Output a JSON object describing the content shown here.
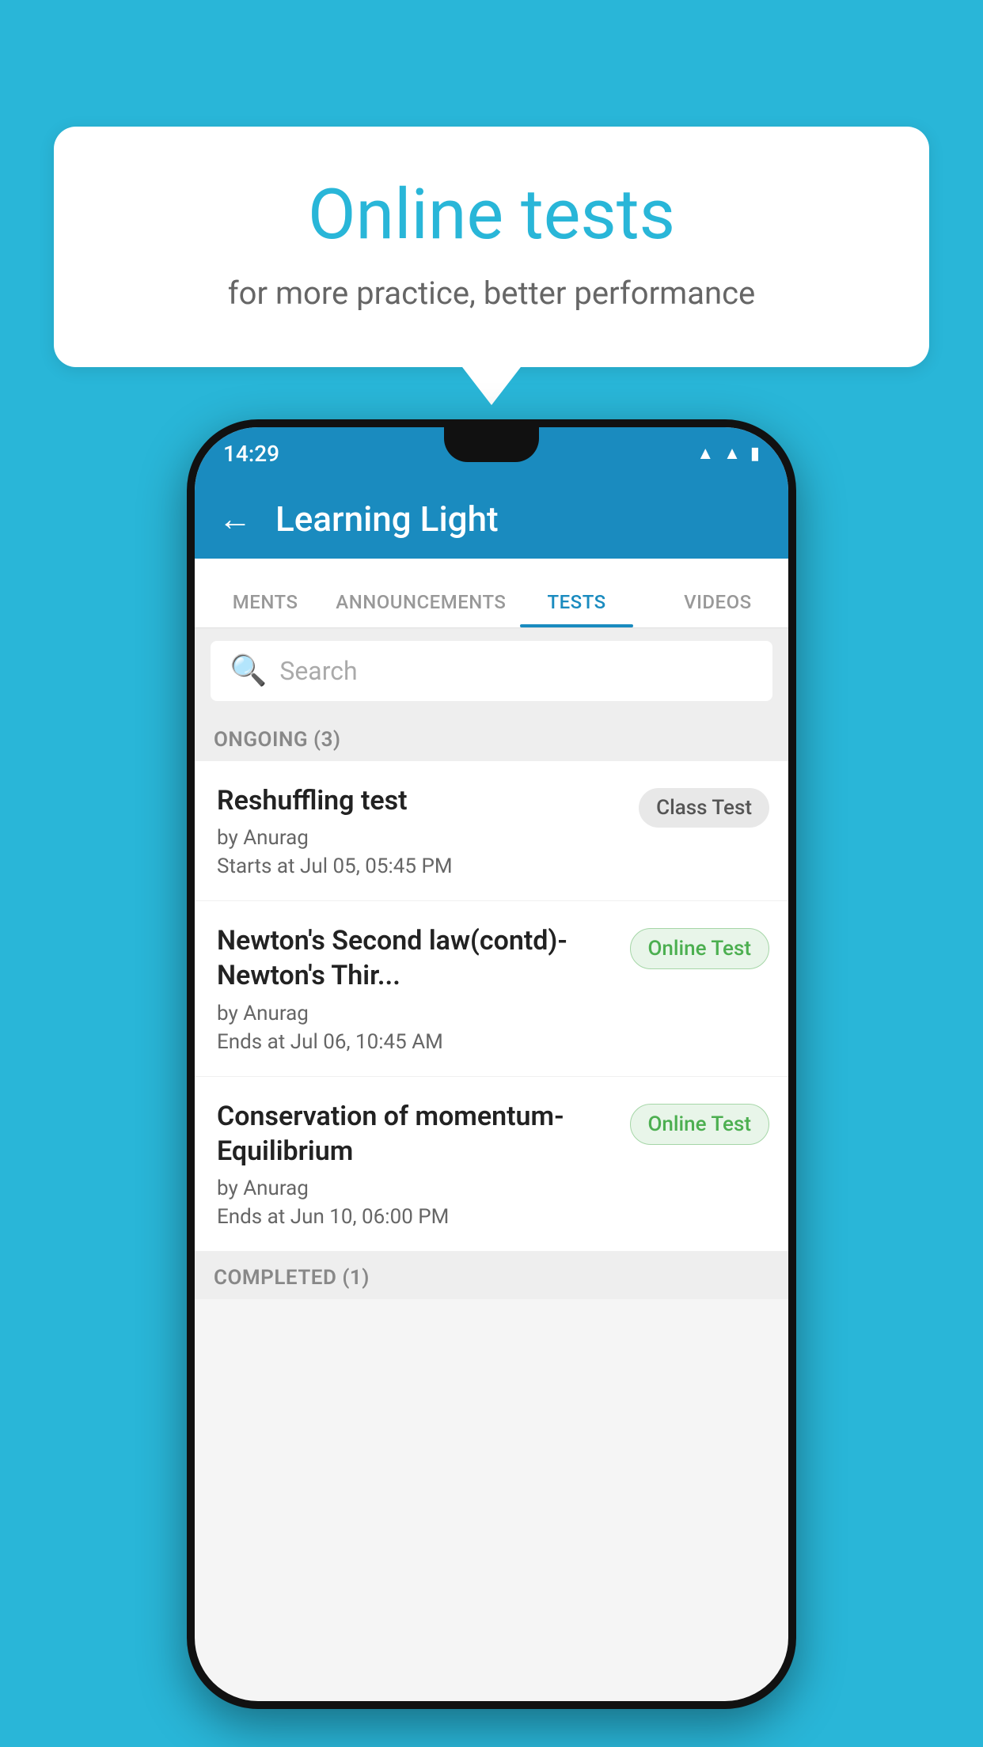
{
  "background": {
    "color": "#29b6d8"
  },
  "speech_bubble": {
    "title": "Online tests",
    "subtitle": "for more practice, better performance"
  },
  "phone": {
    "status_bar": {
      "time": "14:29",
      "icons": [
        "wifi",
        "signal",
        "battery"
      ]
    },
    "app_bar": {
      "title": "Learning Light",
      "back_label": "←"
    },
    "tabs": [
      {
        "label": "MENTS",
        "active": false
      },
      {
        "label": "ANNOUNCEMENTS",
        "active": false
      },
      {
        "label": "TESTS",
        "active": true
      },
      {
        "label": "VIDEOS",
        "active": false
      }
    ],
    "search": {
      "placeholder": "Search"
    },
    "ongoing_section": {
      "header": "ONGOING (3)",
      "items": [
        {
          "name": "Reshuffling test",
          "author": "by Anurag",
          "time_label": "Starts at",
          "time": "Jul 05, 05:45 PM",
          "badge": "Class Test",
          "badge_type": "class"
        },
        {
          "name": "Newton's Second law(contd)-Newton's Thir...",
          "author": "by Anurag",
          "time_label": "Ends at",
          "time": "Jul 06, 10:45 AM",
          "badge": "Online Test",
          "badge_type": "online"
        },
        {
          "name": "Conservation of momentum-Equilibrium",
          "author": "by Anurag",
          "time_label": "Ends at",
          "time": "Jun 10, 06:00 PM",
          "badge": "Online Test",
          "badge_type": "online"
        }
      ]
    },
    "completed_section": {
      "header": "COMPLETED (1)"
    }
  }
}
